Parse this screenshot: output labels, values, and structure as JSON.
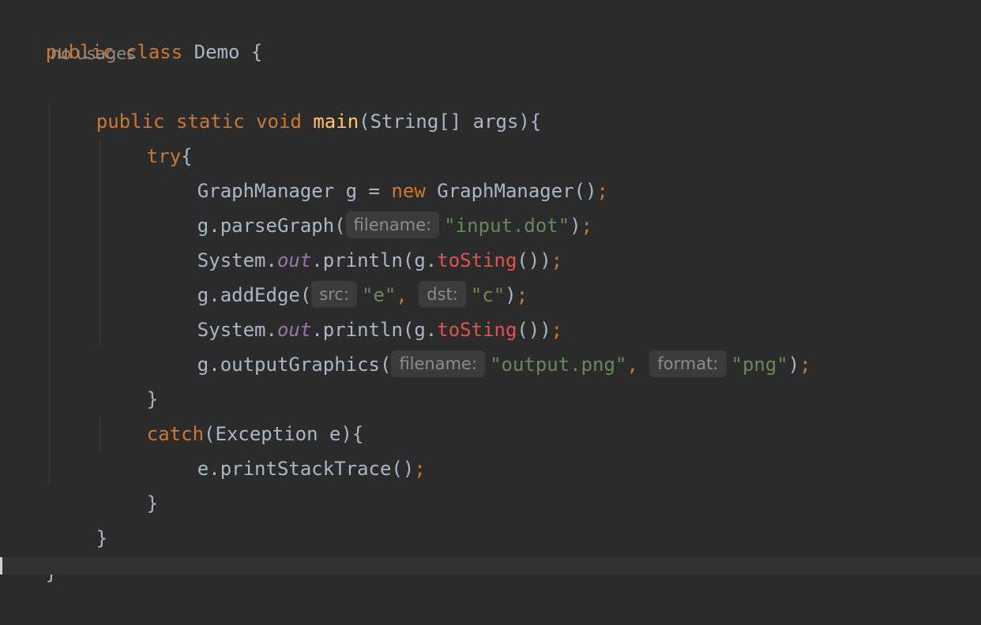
{
  "code": {
    "class_decl": {
      "kw1": "public",
      "kw2": "class",
      "name": "Demo",
      "brace": "{"
    },
    "usages_hint": "no usages",
    "main_decl": {
      "kw1": "public",
      "kw2": "static",
      "kw3": "void",
      "method": "main",
      "params": "(String[] args){"
    },
    "try_kw": "try",
    "try_brace": "{",
    "stmt1": {
      "type": "GraphManager",
      "var": " g = ",
      "kw": "new",
      "ctor": " GraphManager()",
      "semi": ";"
    },
    "stmt2": {
      "call": "g.parseGraph(",
      "hint": "filename:",
      "arg": "\"input.dot\"",
      "close": ")",
      "semi": ";"
    },
    "stmt3": {
      "pre": "System.",
      "field": "out",
      "mid": ".println(g.",
      "method": "toSting",
      "close": "())",
      "semi": ";"
    },
    "stmt4": {
      "call": "g.addEdge(",
      "hint1": "src:",
      "arg1": "\"e\"",
      "comma": ", ",
      "hint2": "dst:",
      "arg2": "\"c\"",
      "close": ")",
      "semi": ";"
    },
    "stmt5": {
      "pre": "System.",
      "field": "out",
      "mid": ".println(g.",
      "method": "toSting",
      "close": "())",
      "semi": ";"
    },
    "stmt6": {
      "call": "g.outputGraphics(",
      "hint1": "filename:",
      "arg1": "\"output.png\"",
      "comma": ", ",
      "hint2": "format:",
      "arg2": "\"png\"",
      "close": ")",
      "semi": ";"
    },
    "try_close": "}",
    "catch_kw": "catch",
    "catch_params": "(Exception e){",
    "catch_stmt": {
      "call": "e.printStackTrace()",
      "semi": ";"
    },
    "catch_close": "}",
    "main_close": "}",
    "class_close": "}"
  },
  "colors": {
    "background": "#2b2b2b",
    "keyword": "#cc7832",
    "method_decl": "#ffc66d",
    "string": "#6a8759",
    "static_field": "#9876aa",
    "unresolved": "#e05252",
    "text": "#a9b7c6"
  }
}
